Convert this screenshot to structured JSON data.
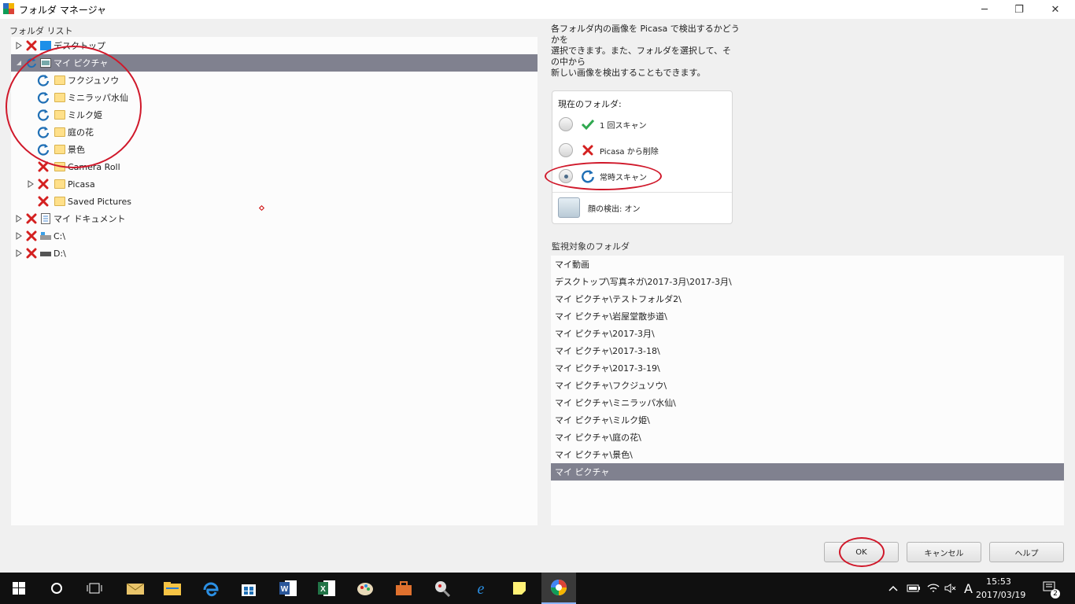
{
  "window": {
    "title": "フォルダ マネージャ",
    "minimize": "─",
    "restore": "❐",
    "close": "✕"
  },
  "folder_list": {
    "label": "フォルダ リスト",
    "items": [
      {
        "label": "デスクトップ",
        "status": "exclude",
        "icon": "desktop-icon"
      },
      {
        "label": "マイ ピクチャ",
        "status": "watch",
        "icon": "pictures-icon",
        "selected": true
      },
      {
        "label": "フクジュソウ",
        "status": "watch",
        "icon": "folder-icon"
      },
      {
        "label": "ミニラッパ水仙",
        "status": "watch",
        "icon": "folder-icon"
      },
      {
        "label": "ミルク姫",
        "status": "watch",
        "icon": "folder-icon"
      },
      {
        "label": "庭の花",
        "status": "watch",
        "icon": "folder-icon"
      },
      {
        "label": "景色",
        "status": "watch",
        "icon": "folder-icon"
      },
      {
        "label": "Camera Roll",
        "status": "exclude",
        "icon": "folder-icon"
      },
      {
        "label": "Picasa",
        "status": "exclude",
        "icon": "folder-icon"
      },
      {
        "label": "Saved Pictures",
        "status": "exclude",
        "icon": "folder-icon"
      },
      {
        "label": "マイ ドキュメント",
        "status": "exclude",
        "icon": "documents-icon"
      },
      {
        "label": "C:\\",
        "status": "exclude",
        "icon": "drive-icon"
      },
      {
        "label": "D:\\",
        "status": "exclude",
        "icon": "drive-icon"
      }
    ]
  },
  "info_text": {
    "line1": "各フォルダ内の画像を Picasa で検出するかどうかを",
    "line2": "選択できます。また、フォルダを選択して、その中から",
    "line3": "新しい画像を検出することもできます。"
  },
  "current_folder": {
    "label": "現在のフォルダ:",
    "options": [
      {
        "label": "1 回スキャン",
        "icon": "checkmark-icon",
        "selected": false
      },
      {
        "label": "Picasa から削除",
        "icon": "red-x-icon",
        "selected": false
      },
      {
        "label": "常時スキャン",
        "icon": "refresh-icon",
        "selected": true
      }
    ],
    "face_detection": "顔の検出: オン"
  },
  "watched": {
    "label": "監視対象のフォルダ",
    "items": [
      "マイ動画",
      "デスクトップ\\写真ネガ\\2017-3月\\2017-3月\\",
      "マイ ピクチャ\\テストフォルダ2\\",
      "マイ ピクチャ\\岩屋堂散歩道\\",
      "マイ ピクチャ\\2017-3月\\",
      "マイ ピクチャ\\2017-3-18\\",
      "マイ ピクチャ\\2017-3-19\\",
      "マイ ピクチャ\\フクジュソウ\\",
      "マイ ピクチャ\\ミニラッパ水仙\\",
      "マイ ピクチャ\\ミルク姫\\",
      "マイ ピクチャ\\庭の花\\",
      "マイ ピクチャ\\景色\\",
      "マイ ピクチャ"
    ],
    "selected_index": 12
  },
  "buttons": {
    "ok": "OK",
    "cancel": "キャンセル",
    "help": "ヘルプ"
  },
  "taskbar": {
    "ime": "A",
    "time": "15:53",
    "date": "2017/03/19",
    "notifications": "2"
  },
  "colors": {
    "selection": "#80818f",
    "annotation": "#d0182a",
    "refresh": "#1f6fb5",
    "exclude": "#d42020",
    "check": "#2fa84f"
  }
}
